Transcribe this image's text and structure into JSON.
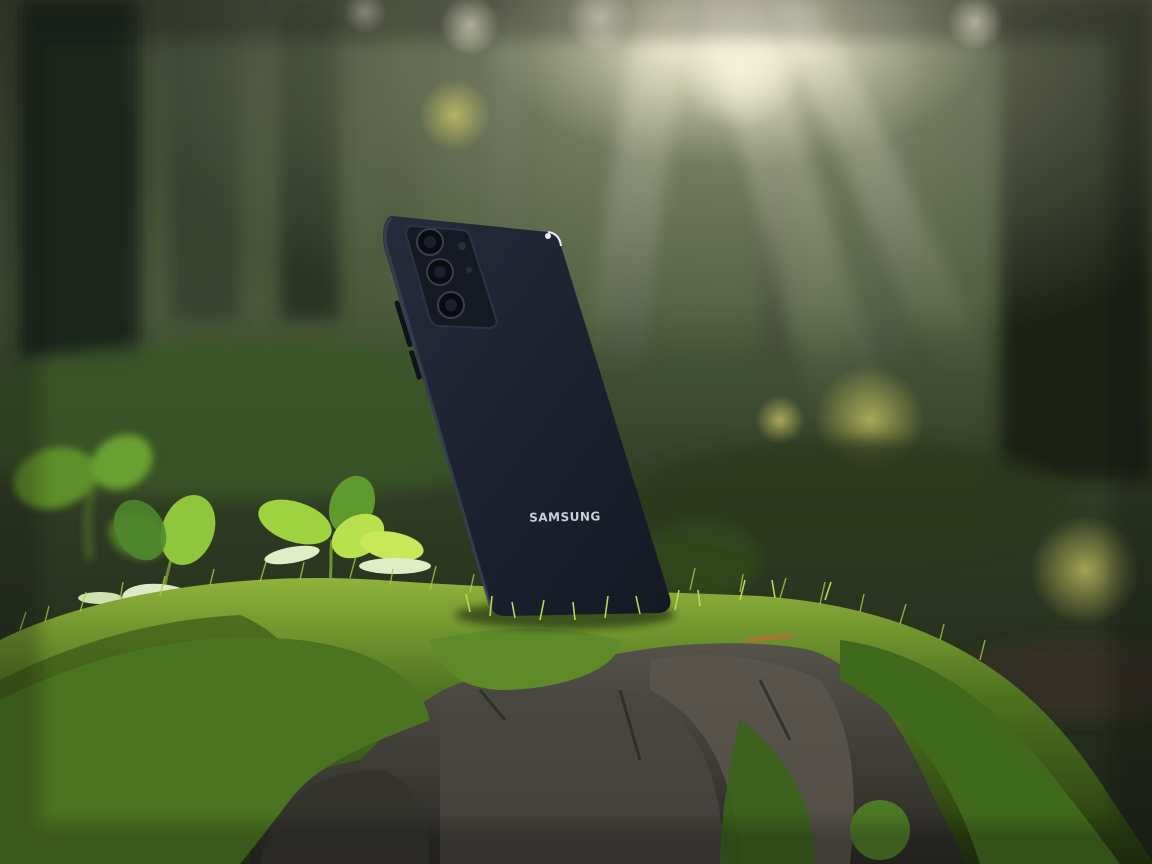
{
  "photo": {
    "subject": "smartphone-on-moss",
    "brand_mark": "SAMSUNG",
    "palette": {
      "phone_body": "#1c2230",
      "moss_light": "#8fb33a",
      "moss_dark": "#2f4a14",
      "rock": "#3b3a36",
      "forest_bg": "#2a3320",
      "sunlight": "#fffbe8"
    }
  }
}
